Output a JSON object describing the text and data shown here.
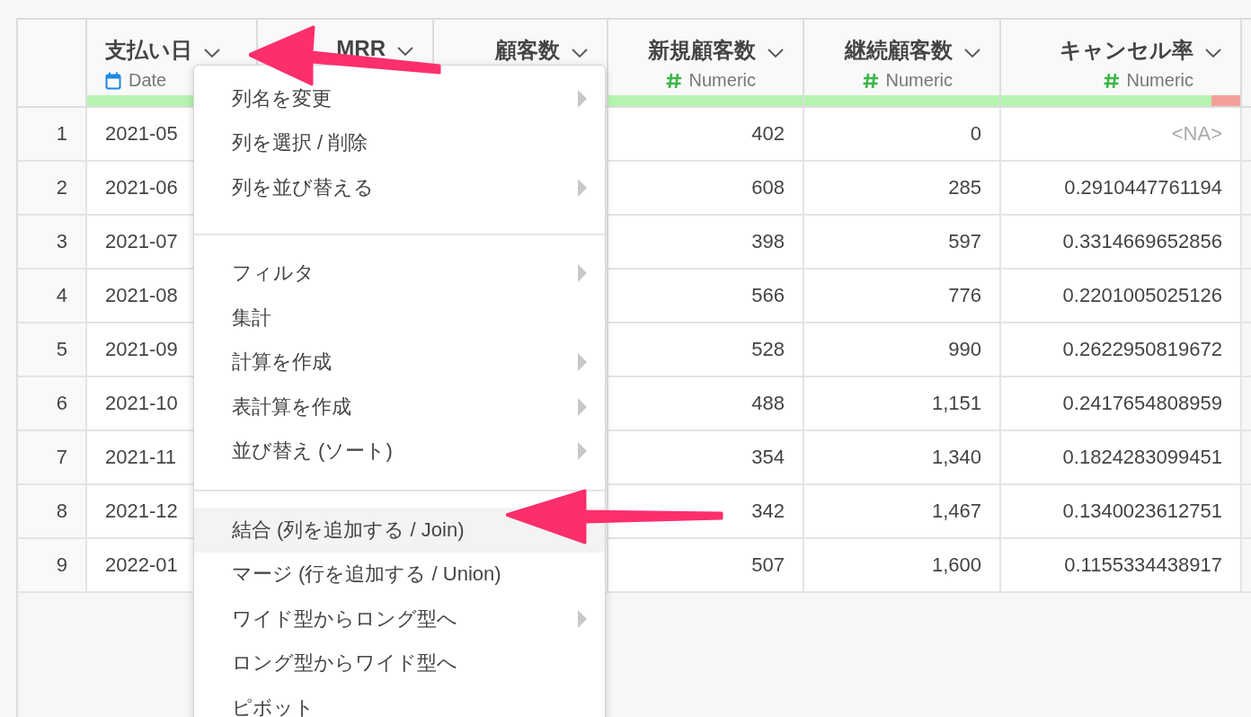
{
  "columns": [
    {
      "name": "支払い日",
      "kind": "date",
      "type_label": "Date",
      "level": 1
    },
    {
      "name": "MRR",
      "kind": "numeric"
    },
    {
      "name": "顧客数",
      "kind": "numeric"
    },
    {
      "name": "新規顧客数",
      "kind": "numeric",
      "type_label": "Numeric",
      "level": 1
    },
    {
      "name": "継続顧客数",
      "kind": "numeric",
      "type_label": "Numeric",
      "level": 1
    },
    {
      "name": "キャンセル率",
      "kind": "numeric",
      "type_label": "Numeric",
      "level": 0.88
    }
  ],
  "rows": [
    {
      "number": "1",
      "date": "2021-05",
      "new": "402",
      "continuing": "0",
      "cancel_rate": {
        "text": "<NA>",
        "missing": true
      }
    },
    {
      "number": "2",
      "date": "2021-06",
      "new": "608",
      "continuing": "285",
      "cancel_rate": {
        "text": "0.2910447761194",
        "missing": false
      }
    },
    {
      "number": "3",
      "date": "2021-07",
      "new": "398",
      "continuing": "597",
      "cancel_rate": {
        "text": "0.3314669652856",
        "missing": false
      }
    },
    {
      "number": "4",
      "date": "2021-08",
      "new": "566",
      "continuing": "776",
      "cancel_rate": {
        "text": "0.2201005025126",
        "missing": false
      }
    },
    {
      "number": "5",
      "date": "2021-09",
      "new": "528",
      "continuing": "990",
      "cancel_rate": {
        "text": "0.2622950819672",
        "missing": false
      }
    },
    {
      "number": "6",
      "date": "2021-10",
      "new": "488",
      "continuing": "1,151",
      "cancel_rate": {
        "text": "0.2417654808959",
        "missing": false
      }
    },
    {
      "number": "7",
      "date": "2021-11",
      "new": "354",
      "continuing": "1,340",
      "cancel_rate": {
        "text": "0.1824283099451",
        "missing": false
      }
    },
    {
      "number": "8",
      "date": "2021-12",
      "new": "342",
      "continuing": "1,467",
      "cancel_rate": {
        "text": "0.1340023612751",
        "missing": false
      }
    },
    {
      "number": "9",
      "date": "2022-01",
      "new": "507",
      "continuing": "1,600",
      "cancel_rate": {
        "text": "0.1155334438917",
        "missing": false
      }
    }
  ],
  "menu": {
    "sections": [
      [
        {
          "label": "列名を変更",
          "submenu": true,
          "selected": false
        },
        {
          "label": "列を選択 / 削除",
          "submenu": false,
          "selected": false
        },
        {
          "label": "列を並び替える",
          "submenu": true,
          "selected": false
        }
      ],
      [
        {
          "label": "フィルタ",
          "submenu": true,
          "selected": false
        },
        {
          "label": "集計",
          "submenu": false,
          "selected": false
        },
        {
          "label": "計算を作成",
          "submenu": true,
          "selected": false
        },
        {
          "label": "表計算を作成",
          "submenu": true,
          "selected": false
        },
        {
          "label": "並び替え (ソート)",
          "submenu": true,
          "selected": false
        }
      ],
      [
        {
          "label": "結合 (列を追加する / Join)",
          "submenu": false,
          "selected": true
        },
        {
          "label": "マージ (行を追加する / Union)",
          "submenu": false,
          "selected": false
        },
        {
          "label": "ワイド型からロング型へ",
          "submenu": true,
          "selected": false
        },
        {
          "label": "ロング型からワイド型へ",
          "submenu": false,
          "selected": false
        },
        {
          "label": "ピボット",
          "submenu": false,
          "selected": false
        }
      ]
    ]
  }
}
